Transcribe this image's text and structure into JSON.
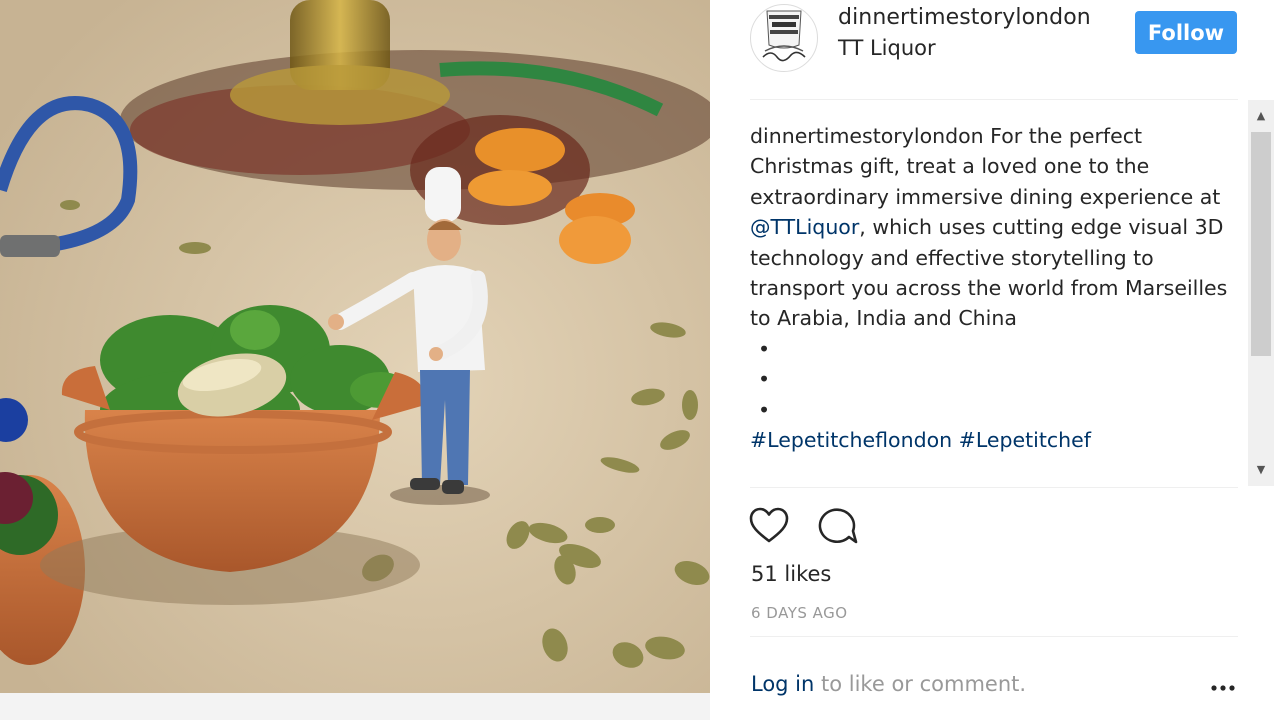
{
  "post": {
    "author": {
      "username": "dinnertimestorylondon",
      "location": "TT Liquor",
      "avatar_icon": "dinner-time-story-logo",
      "follow_label": "Follow"
    },
    "caption": {
      "owner": "dinnertimestorylondon",
      "text_part1": " For the perfect Christmas gift, treat a loved one to the extraordinary immersive dining experience at ",
      "mention": "@TTLiquor",
      "text_part2": ", which uses cutting edge visual 3D technology and effective storytelling to transport you across the world from Marseilles to Arabia, India and China",
      "dots": [
        "•",
        "•",
        "•"
      ],
      "hashtags": [
        "#Lepetitcheflondon",
        "#Lepetitchef"
      ]
    },
    "actions": {
      "like_icon": "heart-icon",
      "comment_icon": "comment-icon"
    },
    "likes": "51 likes",
    "time": "6 DAYS AGO",
    "login": {
      "link": "Log in",
      "rest": " to like or comment."
    },
    "more_icon": "more-options-icon"
  },
  "colors": {
    "accent": "#3897f0",
    "link": "#003569",
    "muted": "#999999",
    "text": "#262626"
  },
  "scrollbar": {
    "up_glyph": "▲",
    "down_glyph": "▼"
  }
}
